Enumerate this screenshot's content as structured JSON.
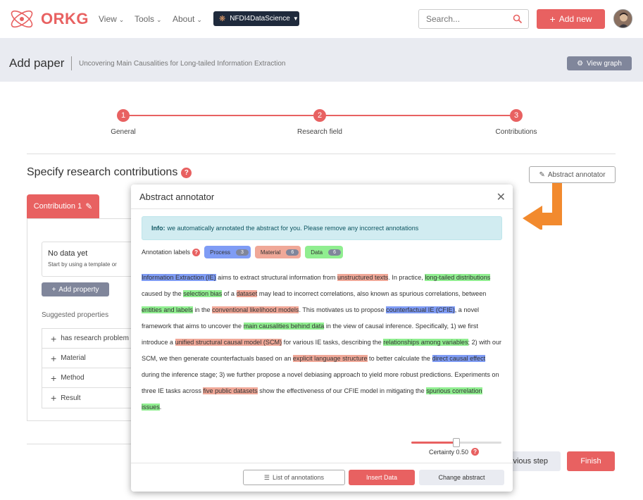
{
  "colors": {
    "brand": "#e86161",
    "process": "#7f9cf5",
    "material": "#f0a898",
    "data": "#90ee90",
    "info_bg": "#d1ecf1",
    "header_bg": "#e9ebf1"
  },
  "navbar": {
    "logo_text": "ORKG",
    "links": [
      "View",
      "Tools",
      "About"
    ],
    "nfdi_label": "NFDI4DataScience",
    "search_placeholder": "Search...",
    "add_new_label": "Add new",
    "icons": [
      "orkg-logo-icon",
      "chevron-down-icon",
      "search-icon",
      "plus-icon",
      "avatar"
    ]
  },
  "header": {
    "title": "Add paper",
    "subtitle": "Uncovering Main Causalities for Long-tailed Information Extraction",
    "view_graph_label": "View graph"
  },
  "stepper": {
    "steps": [
      {
        "number": "1",
        "label": "General"
      },
      {
        "number": "2",
        "label": "Research field"
      },
      {
        "number": "3",
        "label": "Contributions"
      }
    ]
  },
  "main": {
    "title": "Specify research contributions",
    "abstract_annotator_label": "Abstract annotator",
    "contribution_tab": "Contribution 1",
    "no_data_title": "No data yet",
    "no_data_sub": "Start by using a template or",
    "add_property_label": "Add property",
    "suggested_label": "Suggested properties",
    "suggested": [
      "has research problem",
      "Material",
      "Method",
      "Result"
    ],
    "prev_step_label": "Previous step",
    "finish_label": "Finish"
  },
  "modal": {
    "title": "Abstract annotator",
    "info_bold": "Info:",
    "info_text": "we automatically annotated the abstract for you. Please remove any incorrect annotations",
    "labels_caption": "Annotation labels",
    "chips": [
      {
        "label": "Process",
        "count": "3"
      },
      {
        "label": "Material",
        "count": "6"
      },
      {
        "label": "Data",
        "count": "6"
      }
    ],
    "abstract_segments": [
      {
        "t": "Information Extraction (IE)",
        "c": "p"
      },
      {
        "t": " aims to extract structural information from "
      },
      {
        "t": "unstructured texts",
        "c": "m"
      },
      {
        "t": ". In practice, "
      },
      {
        "t": "long-tailed distributions",
        "c": "d"
      },
      {
        "t": " caused by the "
      },
      {
        "t": "selection bias",
        "c": "d"
      },
      {
        "t": " of a "
      },
      {
        "t": "dataset",
        "c": "m"
      },
      {
        "t": " may lead to incorrect correlations, also known as spurious correlations, between "
      },
      {
        "t": "entities and labels",
        "c": "d"
      },
      {
        "t": " in the "
      },
      {
        "t": "conventional likelihood models",
        "c": "m"
      },
      {
        "t": ". This motivates us to propose "
      },
      {
        "t": "counterfactual IE (CFIE)",
        "c": "p"
      },
      {
        "t": ", a novel framework that aims to uncover the "
      },
      {
        "t": "main causalities behind data",
        "c": "d"
      },
      {
        "t": " in the view of causal inference. Specifically, 1) we first introduce a "
      },
      {
        "t": "unified structural causal model (SCM)",
        "c": "m"
      },
      {
        "t": " for various IE tasks, describing the "
      },
      {
        "t": "relationships among variables",
        "c": "d"
      },
      {
        "t": "; 2) with our SCM, we then generate counterfactuals based on an "
      },
      {
        "t": "explicit language structure",
        "c": "m"
      },
      {
        "t": " to better calculate the "
      },
      {
        "t": "direct causal effect",
        "c": "p"
      },
      {
        "t": " during the inference stage; 3) we further propose a novel debiasing approach to yield more robust predictions. Experiments on three IE tasks across "
      },
      {
        "t": "five public datasets",
        "c": "m"
      },
      {
        "t": " show the effectiveness of our CFIE model in mitigating the "
      },
      {
        "t": "spurious correlation issues",
        "c": "d"
      },
      {
        "t": "."
      }
    ],
    "certainty_label": "Certainty 0.50",
    "certainty_value": 0.5,
    "list_label": "List of annotations",
    "insert_label": "Insert Data",
    "change_label": "Change abstract"
  }
}
